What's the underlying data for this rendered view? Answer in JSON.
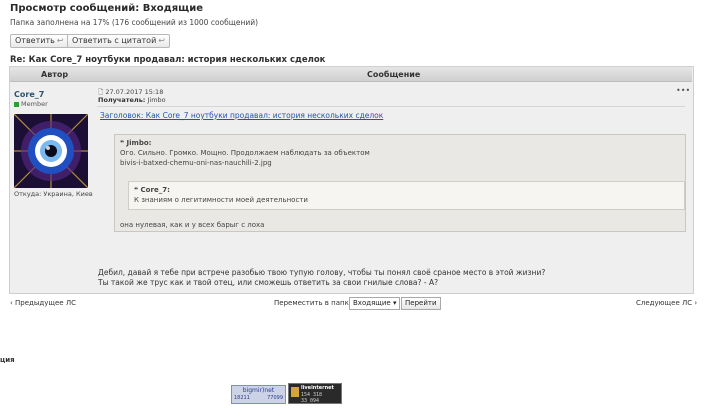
{
  "page": {
    "title": "Просмотр сообщений: Входящие",
    "folder_caption": "Папка заполнена на 17% (176 сообщений из 1000 сообщений)"
  },
  "toolbar": {
    "reply_label": "Ответить",
    "quote_reply_label": "Ответить с цитатой"
  },
  "message": {
    "subject": "Re: Как Core_7 ноутбуки продавал: история нескольких сделок",
    "col_author": "Автор",
    "col_message": "Сообщение",
    "author": {
      "name": "Core_7",
      "rank": "Member",
      "location": "Откуда: Украина, Киев"
    },
    "date": "27.07.2017 15:18",
    "recipient_label": "Получатель:",
    "recipient": "Jimbo",
    "header_link": "Заголовок: Как Core_7 ноутбуки продавал: история нескольких сделок",
    "quote_outer": {
      "author": "Jimbo:",
      "line1": "Ого. Сильно. Громко. Мощно. Продолжаем наблюдать за объектом",
      "line2": "bivis-i-batxed-chemu-oni-nas-nauchili-2.jpg",
      "after": "она нулевая, как и у всех барыг с лоха"
    },
    "quote_inner": {
      "author": "Core_7:",
      "text": "К знаниям о легитимности моей деятельности"
    },
    "body_line1": "Дебил, давай я тебе при встрече разобью твою тупую голову, чтобы ты понял своё сраное место в этой жизни?",
    "body_line2": "Ты такой же трус как и твой отец, или сможешь ответить за свои гнилые слова? - А?"
  },
  "nav": {
    "prev": "‹ Предыдущее ЛС",
    "move_label": "Переместить в папку:",
    "folder_value": "Входящие",
    "go": "Перейти",
    "next": "Следующее ЛС ›"
  },
  "footer": {
    "cut_text": "ция",
    "counter1": {
      "title": "bigmir)net",
      "v1": "18211",
      "v2": "77099"
    },
    "counter2": {
      "title": "liveinternet",
      "l1": "154 318",
      "l2": "33 094"
    }
  },
  "icons": [
    "reply-icon",
    "quote-reply-icon",
    "document-icon",
    "menu-dots-icon",
    "quote-icon",
    "chevron-down-icon"
  ],
  "colors": {
    "link": "#2a4fb0",
    "author": "#2c5470",
    "online": "#2c9e36",
    "panel": "#efefef"
  }
}
